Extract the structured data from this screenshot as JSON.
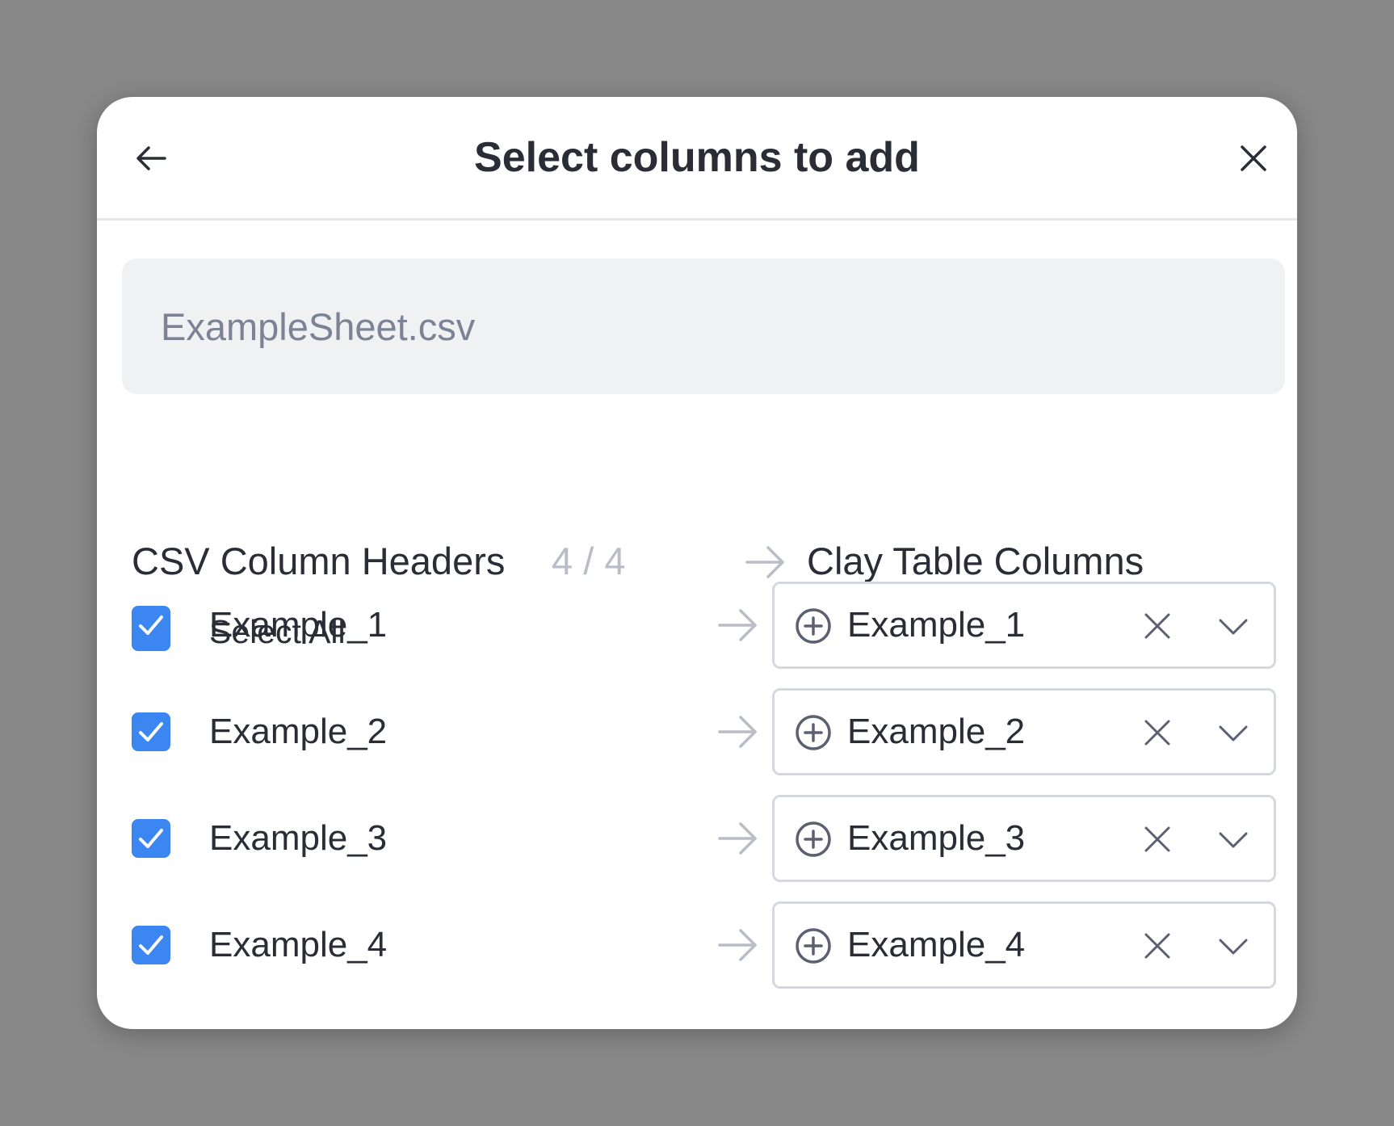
{
  "dialog": {
    "title": "Select columns to add",
    "back_icon": "arrow-left-icon",
    "close_icon": "close-icon"
  },
  "file": {
    "name": "ExampleSheet.csv"
  },
  "columns_header": {
    "csv_label": "CSV Column Headers",
    "count": "4 / 4",
    "clay_label": "Clay Table Columns"
  },
  "select_all": {
    "label": "Select All",
    "checked": true
  },
  "mappings": [
    {
      "csv_column": "Example_1",
      "clay_column": "Example_1",
      "checked": true
    },
    {
      "csv_column": "Example_2",
      "clay_column": "Example_2",
      "checked": true
    },
    {
      "csv_column": "Example_3",
      "clay_column": "Example_3",
      "checked": true
    },
    {
      "csv_column": "Example_4",
      "clay_column": "Example_4",
      "checked": true
    }
  ],
  "colors": {
    "checkbox": "#3b86f0",
    "text": "#2a2d36",
    "muted": "#b9bdc6",
    "file_box_bg": "#f0f1f3"
  }
}
